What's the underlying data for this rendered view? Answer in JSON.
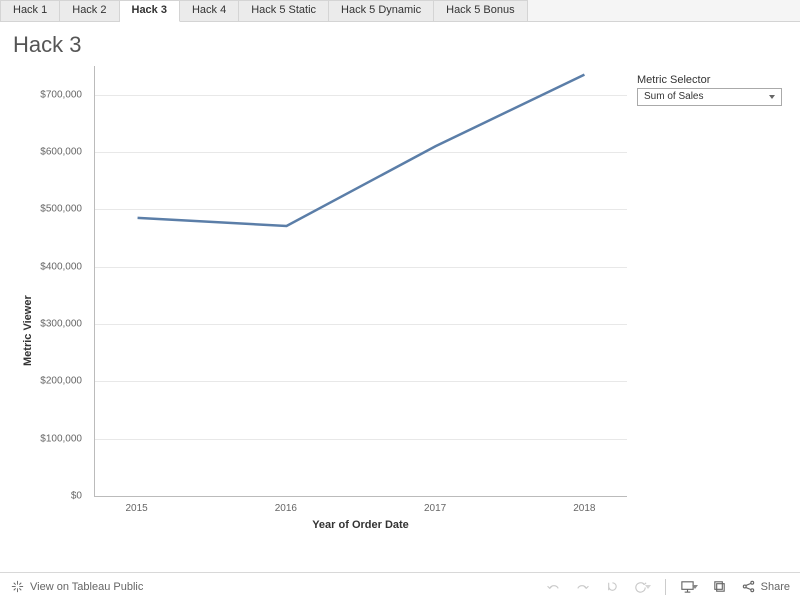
{
  "tabs": [
    {
      "label": "Hack 1",
      "active": false
    },
    {
      "label": "Hack 2",
      "active": false
    },
    {
      "label": "Hack 3",
      "active": true
    },
    {
      "label": "Hack 4",
      "active": false
    },
    {
      "label": "Hack 5 Static",
      "active": false
    },
    {
      "label": "Hack 5 Dynamic",
      "active": false
    },
    {
      "label": "Hack 5 Bonus",
      "active": false
    }
  ],
  "title": "Hack 3",
  "selector": {
    "label": "Metric Selector",
    "value": "Sum of Sales"
  },
  "chart_data": {
    "type": "line",
    "xlabel": "Year of Order Date",
    "ylabel": "Metric Viewer",
    "x": [
      "2015",
      "2016",
      "2017",
      "2018"
    ],
    "values": [
      485000,
      471000,
      610000,
      735000
    ],
    "ylim": [
      0,
      750000
    ],
    "yticks": [
      0,
      100000,
      200000,
      300000,
      400000,
      500000,
      600000,
      700000
    ],
    "ytick_labels": [
      "$0",
      "$100,000",
      "$200,000",
      "$300,000",
      "$400,000",
      "$500,000",
      "$600,000",
      "$700,000"
    ],
    "line_color": "#5b7ea8"
  },
  "toolbar": {
    "view_label": "View on Tableau Public",
    "share_label": "Share"
  }
}
